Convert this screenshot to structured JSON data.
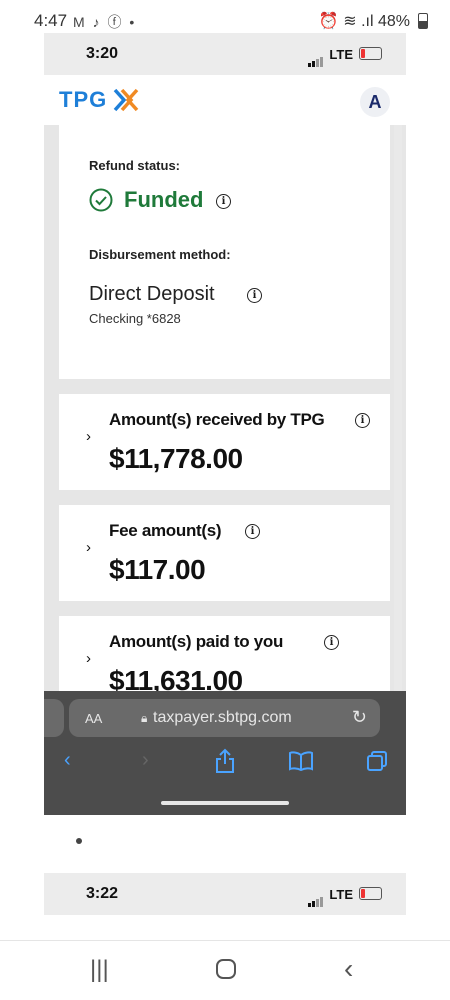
{
  "android_status": {
    "time": "4:47",
    "notification_icons": "M ♪ ⓕ •",
    "right": "⏰ ≋ .ıl 48%"
  },
  "ios_status_1": {
    "time": "3:20",
    "network": "LTE"
  },
  "header": {
    "logo_text": "TPG",
    "avatar_initial": "A"
  },
  "refund": {
    "status_label": "Refund status:",
    "status_value": "Funded",
    "method_label": "Disbursement method:",
    "method_value": "Direct Deposit",
    "account": "Checking *6828"
  },
  "amounts": [
    {
      "label": "Amount(s) received by TPG",
      "value": "$11,778.00"
    },
    {
      "label": "Fee amount(s)",
      "value": "$117.00"
    },
    {
      "label": "Amount(s) paid to you",
      "value": "$11,631.00"
    }
  ],
  "safari": {
    "text_size_button": "AA",
    "url": "taxpayer.sbtpg.com"
  },
  "ios_status_2": {
    "time": "3:22",
    "network": "LTE"
  },
  "colors": {
    "brand_blue": "#1e7fd8",
    "brand_orange": "#f08a24",
    "funded_green": "#1f7a3a",
    "safari_blue": "#4aa3ff"
  },
  "icons": [
    "check-circle-icon",
    "info-icon",
    "chevron-right-icon",
    "lock-icon",
    "reload-icon",
    "back-icon",
    "forward-icon",
    "share-icon",
    "bookmarks-icon",
    "tabs-icon"
  ]
}
